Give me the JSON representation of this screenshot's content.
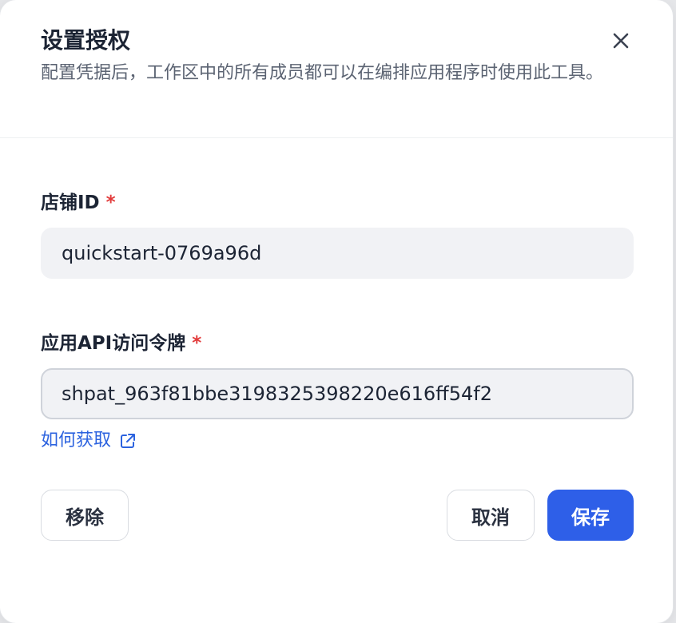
{
  "dialog": {
    "title": "设置授权",
    "description": "配置凭据后，工作区中的所有成员都可以在编排应用程序时使用此工具。",
    "close_icon": "close-icon"
  },
  "form": {
    "store_id": {
      "label": "店铺ID",
      "required_mark": "*",
      "value": "quickstart-0769a96d"
    },
    "api_token": {
      "label": "应用API访问令牌",
      "required_mark": "*",
      "value": "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"
    },
    "help_link": {
      "label": "如何获取",
      "icon": "external-link-icon"
    }
  },
  "actions": {
    "remove_label": "移除",
    "cancel_label": "取消",
    "save_label": "保存"
  },
  "colors": {
    "primary": "#2e5fe8",
    "link": "#2b62df",
    "required": "#e23b3b"
  }
}
